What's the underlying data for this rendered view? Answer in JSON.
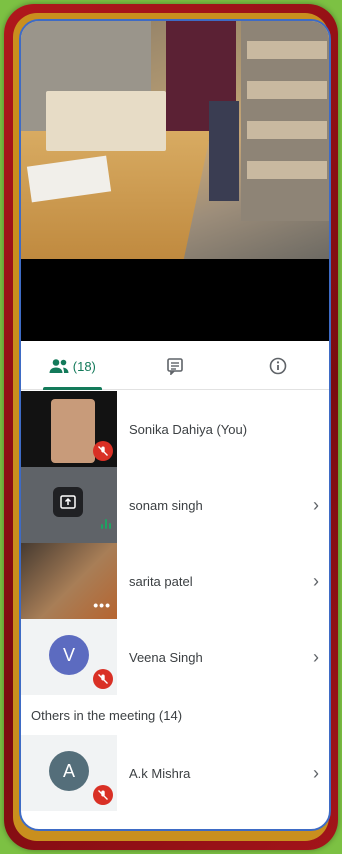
{
  "tabs": {
    "people_count": "(18)",
    "colors": {
      "active": "#137a5a",
      "inactive": "#5f6368"
    }
  },
  "participants": [
    {
      "name": "Sonika Dahiya (You)",
      "thumb": "video",
      "status": "muted",
      "chevron": false
    },
    {
      "name": "sonam singh",
      "thumb": "presenting",
      "status": "speaking",
      "chevron": true
    },
    {
      "name": "sarita patel",
      "thumb": "video",
      "status": "more-options",
      "chevron": true
    },
    {
      "name": "Veena Singh",
      "thumb": "avatar",
      "avatar_letter": "V",
      "avatar_color": "#5c6bc0",
      "status": "muted",
      "chevron": true
    }
  ],
  "others": {
    "header": "Others in the meeting (14)",
    "items": [
      {
        "name": "A.k Mishra",
        "avatar_letter": "A",
        "avatar_color": "#546e7a",
        "status": "muted",
        "chevron": true
      }
    ]
  },
  "frame_colors": {
    "background": "#7cc143",
    "border": "#b0171c",
    "accent": "#3e6bc5"
  }
}
